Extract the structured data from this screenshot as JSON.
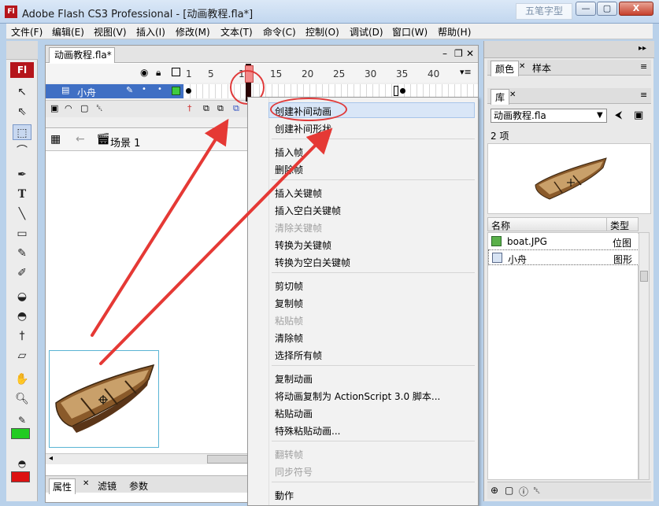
{
  "window": {
    "title": "Adobe Flash CS3 Professional - [动画教程.fla*]",
    "app_icon_label": "Fl",
    "watermark": "五笔字型",
    "min_label": "—",
    "max_label": "▢",
    "close_label": "X"
  },
  "menu": [
    "文件(F)",
    "编辑(E)",
    "视图(V)",
    "插入(I)",
    "修改(M)",
    "文本(T)",
    "命令(C)",
    "控制(O)",
    "调试(D)",
    "窗口(W)",
    "帮助(H)"
  ],
  "tools": {
    "logo": "Fl"
  },
  "document": {
    "tab_label": "动画教程.fla*",
    "timeline": {
      "frame_numbers": [
        "1",
        "5",
        "10",
        "15",
        "20",
        "25",
        "30",
        "35",
        "40"
      ],
      "layer_name": "小舟"
    },
    "scene_label": "场景 1"
  },
  "context_menu": {
    "items": [
      {
        "label": "创建补间动画",
        "disabled": false
      },
      {
        "label": "创建补间形状",
        "disabled": false
      },
      {
        "label": "插入帧",
        "disabled": false
      },
      {
        "label": "删除帧",
        "disabled": false
      },
      {
        "label": "插入关键帧",
        "disabled": false
      },
      {
        "label": "插入空白关键帧",
        "disabled": false
      },
      {
        "label": "清除关键帧",
        "disabled": true
      },
      {
        "label": "转换为关键帧",
        "disabled": false
      },
      {
        "label": "转换为空白关键帧",
        "disabled": false
      },
      {
        "label": "剪切帧",
        "disabled": false
      },
      {
        "label": "复制帧",
        "disabled": false
      },
      {
        "label": "粘贴帧",
        "disabled": true
      },
      {
        "label": "清除帧",
        "disabled": false
      },
      {
        "label": "选择所有帧",
        "disabled": false
      },
      {
        "label": "复制动画",
        "disabled": false
      },
      {
        "label": "将动画复制为 ActionScript 3.0 脚本...",
        "disabled": false
      },
      {
        "label": "粘贴动画",
        "disabled": false
      },
      {
        "label": "特殊粘贴动画...",
        "disabled": false
      },
      {
        "label": "翻转帧",
        "disabled": true
      },
      {
        "label": "同步符号",
        "disabled": true
      },
      {
        "label": "動作",
        "disabled": false
      }
    ]
  },
  "properties_tabs": [
    "属性",
    "滤镜",
    "参数"
  ],
  "right_panel": {
    "color_tabs": [
      "颜色",
      "样本"
    ],
    "library_tab": "库",
    "library_file": "动画教程.fla",
    "item_count": "2 项",
    "columns": {
      "name": "名称",
      "type": "类型"
    },
    "items": [
      {
        "name": "boat.JPG",
        "type": "位图"
      },
      {
        "name": "小舟",
        "type": "图形"
      }
    ]
  },
  "colors": {
    "accent_red": "#e03a3a",
    "layer_selected": "#3f6fc4",
    "stroke_swatch": "#22cc22",
    "fill_swatch": "#dd1111"
  }
}
